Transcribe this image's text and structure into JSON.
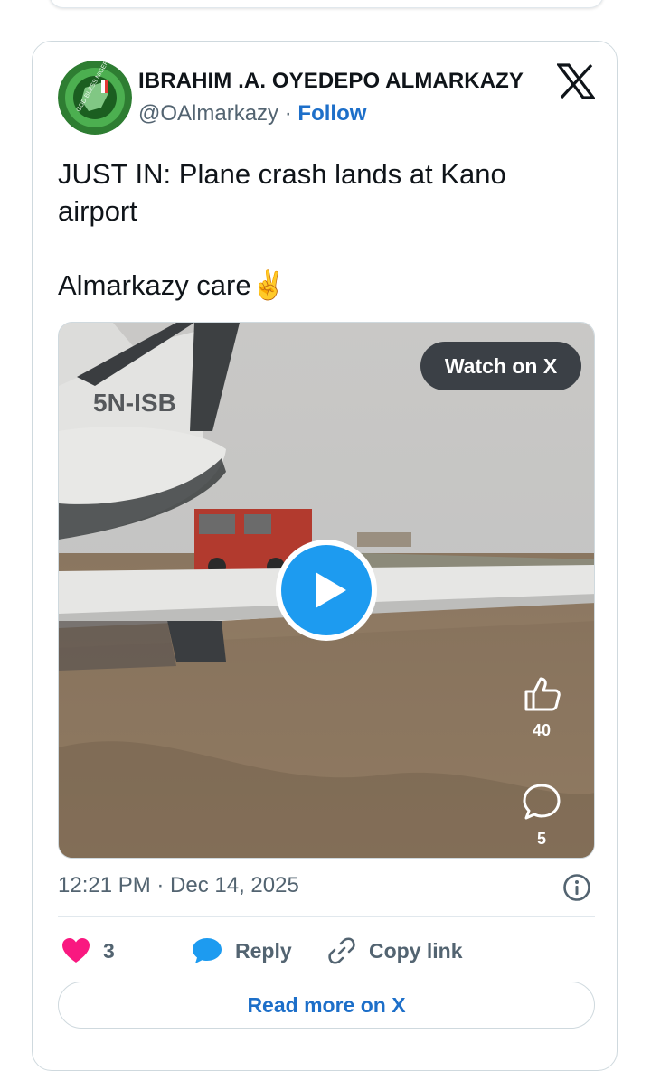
{
  "tweet": {
    "author_name": "IBRAHIM .A. OYEDEPO ALMARKAZY",
    "handle": "@OAlmarkazy",
    "separator": "·",
    "follow_label": "Follow",
    "text_line1": "JUST IN: Plane crash lands at Kano airport",
    "text_line2": "Almarkazy care✌️",
    "avatar_text": "GOD BLESS NIGERIA",
    "media": {
      "watch_label": "Watch on X",
      "aircraft_registration": "5N-ISB",
      "likes_count": "40",
      "comments_count": "5"
    },
    "timestamp": "12:21 PM · Dec 14, 2025",
    "actions": {
      "like_count": "3",
      "reply_label": "Reply",
      "copy_link_label": "Copy link"
    },
    "read_more_label": "Read more on X"
  },
  "icons": {
    "x_logo": "x-logo-icon",
    "play": "play-icon",
    "thumbs_up": "thumbs-up-icon",
    "comment": "comment-icon",
    "info": "info-icon",
    "heart": "heart-icon",
    "reply": "reply-bubble-icon",
    "link": "link-icon"
  },
  "colors": {
    "follow_blue": "#1d6fc9",
    "play_blue": "#1d9bf0",
    "heart_pink": "#f91880",
    "secondary_text": "#536471"
  }
}
